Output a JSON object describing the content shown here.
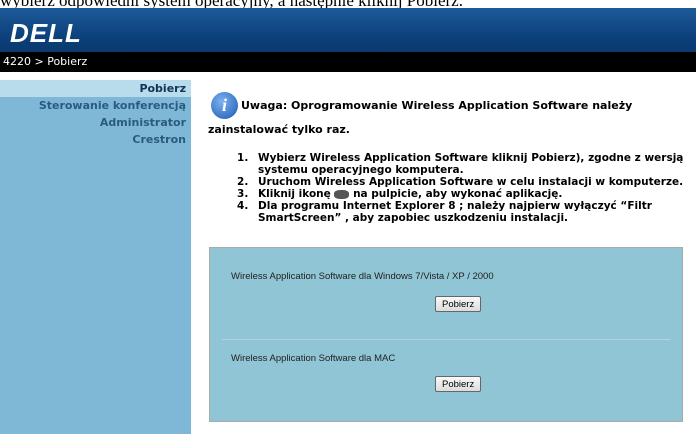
{
  "header": {
    "top_text": "wybierz odpowiedni system operacyjny, a następnie kliknij Pobierz.",
    "logo": "DELL",
    "breadcrumb": "4220 > Pobierz"
  },
  "sidebar": {
    "items": [
      {
        "label": "Pobierz",
        "active": true
      },
      {
        "label": "Sterowanie konferencją",
        "active": false
      },
      {
        "label": "Administrator",
        "active": false
      },
      {
        "label": "Crestron",
        "active": false
      }
    ]
  },
  "main": {
    "notice_line1": "Uwaga: Oprogramowanie Wireless Application Software należy",
    "notice_line2": "zainstalować tylko raz.",
    "steps": [
      "Wybierz Wireless Application Software kliknij Pobierz), zgodne z wersją systemu operacyjnego komputera.",
      "Uruchom Wireless Application Software w celu instalacji w komputerze.",
      "Kliknij ikonę",
      "na pulpicie, aby wykonać aplikację.",
      "Dla programu Internet Explorer 8 ; należy najpierw wyłączyć “Filtr SmartScreen” , aby zapobiec uszkodzeniu instalacji."
    ]
  },
  "downloads": {
    "windows_label": "Wireless Application Software dla Windows 7/Vista / XP / 2000",
    "windows_button": "Pobierz",
    "mac_label": "Wireless Application Software dla MAC",
    "mac_button": "Pobierz"
  }
}
